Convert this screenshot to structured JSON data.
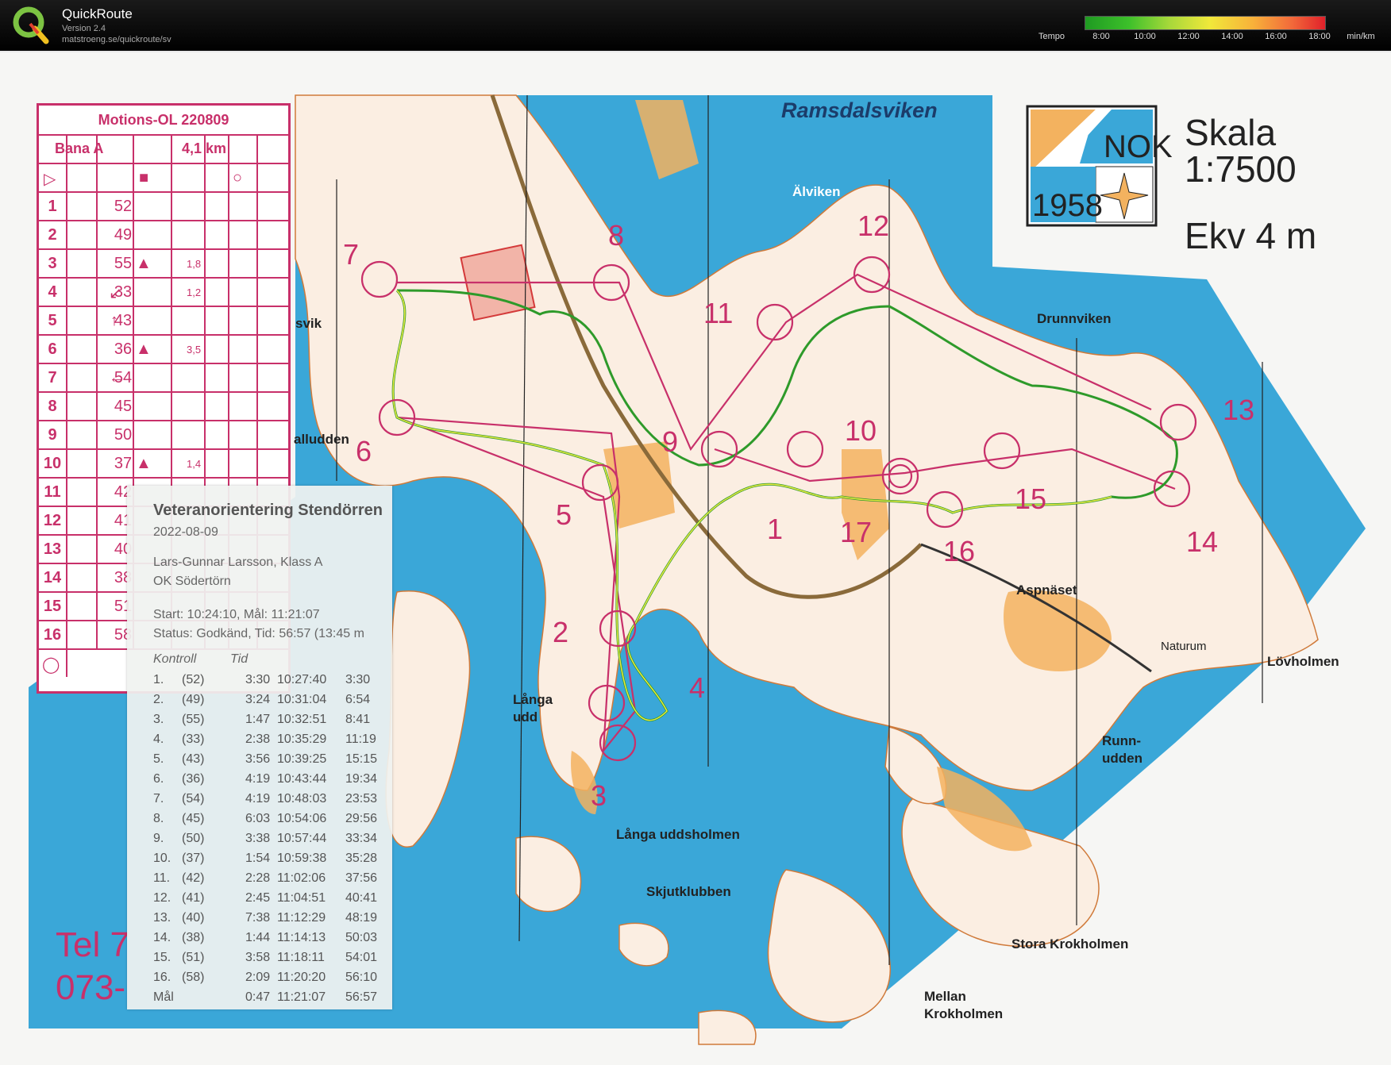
{
  "header": {
    "app_title": "QuickRoute",
    "version": "Version 2.4",
    "url": "matstroeng.se/quickroute/sv",
    "tempo_label": "Tempo",
    "tempo_ticks": [
      "8:00",
      "10:00",
      "12:00",
      "14:00",
      "16:00",
      "18:00",
      "min/km"
    ]
  },
  "legend": {
    "event": "Motions-OL 220809",
    "course": "Bana A",
    "length": "4,1 km",
    "rows": [
      {
        "n": "1",
        "code": "52"
      },
      {
        "n": "2",
        "code": "49"
      },
      {
        "n": "3",
        "code": "55"
      },
      {
        "n": "4",
        "code": "33"
      },
      {
        "n": "5",
        "code": "43"
      },
      {
        "n": "6",
        "code": "36"
      },
      {
        "n": "7",
        "code": "54"
      },
      {
        "n": "8",
        "code": "45"
      },
      {
        "n": "9",
        "code": "50"
      },
      {
        "n": "10",
        "code": "37"
      },
      {
        "n": "11",
        "code": "42"
      },
      {
        "n": "12",
        "code": "41"
      },
      {
        "n": "13",
        "code": "40"
      },
      {
        "n": "14",
        "code": "38"
      },
      {
        "n": "15",
        "code": "51"
      },
      {
        "n": "16",
        "code": "58"
      }
    ],
    "dims": {
      "r3": "1,8",
      "r4": "1,2",
      "r6": "3,5",
      "r10": "1,4"
    }
  },
  "split_card": {
    "title": "Veteranorientering Stendörren",
    "date": "2022-08-09",
    "runner": "Lars-Gunnar Larsson, Klass A",
    "club": "OK Södertörn",
    "start_line": "Start: 10:24:10, Mål: 11:21:07",
    "status_line": "Status: Godkänd, Tid: 56:57 (13:45 m",
    "col_kontroll": "Kontroll",
    "col_tid": "Tid",
    "splits": [
      {
        "k": "1.",
        "c": "(52)",
        "leg": "3:30",
        "clock": "10:27:40",
        "tot": "3:30"
      },
      {
        "k": "2.",
        "c": "(49)",
        "leg": "3:24",
        "clock": "10:31:04",
        "tot": "6:54"
      },
      {
        "k": "3.",
        "c": "(55)",
        "leg": "1:47",
        "clock": "10:32:51",
        "tot": "8:41"
      },
      {
        "k": "4.",
        "c": "(33)",
        "leg": "2:38",
        "clock": "10:35:29",
        "tot": "11:19"
      },
      {
        "k": "5.",
        "c": "(43)",
        "leg": "3:56",
        "clock": "10:39:25",
        "tot": "15:15"
      },
      {
        "k": "6.",
        "c": "(36)",
        "leg": "4:19",
        "clock": "10:43:44",
        "tot": "19:34"
      },
      {
        "k": "7.",
        "c": "(54)",
        "leg": "4:19",
        "clock": "10:48:03",
        "tot": "23:53"
      },
      {
        "k": "8.",
        "c": "(45)",
        "leg": "6:03",
        "clock": "10:54:06",
        "tot": "29:56"
      },
      {
        "k": "9.",
        "c": "(50)",
        "leg": "3:38",
        "clock": "10:57:44",
        "tot": "33:34"
      },
      {
        "k": "10.",
        "c": "(37)",
        "leg": "1:54",
        "clock": "10:59:38",
        "tot": "35:28"
      },
      {
        "k": "11.",
        "c": "(42)",
        "leg": "2:28",
        "clock": "11:02:06",
        "tot": "37:56"
      },
      {
        "k": "12.",
        "c": "(41)",
        "leg": "2:45",
        "clock": "11:04:51",
        "tot": "40:41"
      },
      {
        "k": "13.",
        "c": "(40)",
        "leg": "7:38",
        "clock": "11:12:29",
        "tot": "48:19"
      },
      {
        "k": "14.",
        "c": "(38)",
        "leg": "1:44",
        "clock": "11:14:13",
        "tot": "50:03"
      },
      {
        "k": "15.",
        "c": "(51)",
        "leg": "3:58",
        "clock": "11:18:11",
        "tot": "54:01"
      },
      {
        "k": "16.",
        "c": "(58)",
        "leg": "2:09",
        "clock": "11:20:20",
        "tot": "56:10"
      },
      {
        "k": "Mål",
        "c": "",
        "leg": "0:47",
        "clock": "11:21:07",
        "tot": "56:57"
      }
    ]
  },
  "map": {
    "scale_title": "Skala",
    "scale_value": "1:7500",
    "contour": "Ekv 4 m",
    "logo_text": "NOK",
    "logo_year": "1958",
    "tel_line1": "Tel 7",
    "tel_line2": "073-",
    "places": {
      "ramsdalsviken": "Ramsdalsviken",
      "alviken": "Älviken",
      "drunnviken": "Drunnviken",
      "svik": "svik",
      "alludden": "alludden",
      "aspnaset": "Aspnäset",
      "naturum": "Naturum",
      "lovholmen": "Lövholmen",
      "langa_udd1": "Långa",
      "langa_udd2": "udd",
      "runn1": "Runn-",
      "runn2": "udden",
      "langa_uddsholmen": "Långa uddsholmen",
      "skjutklubben": "Skjutklubben",
      "stora_krokholmen": "Stora Krokholmen",
      "mellan1": "Mellan",
      "mellan2": "Krokholmen"
    },
    "control_numbers": [
      "1",
      "2",
      "3",
      "4",
      "5",
      "6",
      "7",
      "8",
      "9",
      "10",
      "11",
      "12",
      "13",
      "14",
      "15",
      "16",
      "1",
      "7"
    ],
    "colors": {
      "water": "#3aa7d8",
      "land": "#fbeee2",
      "open": "#f3b25f",
      "course": "#c8306a",
      "road": "#8a6a3a"
    }
  }
}
